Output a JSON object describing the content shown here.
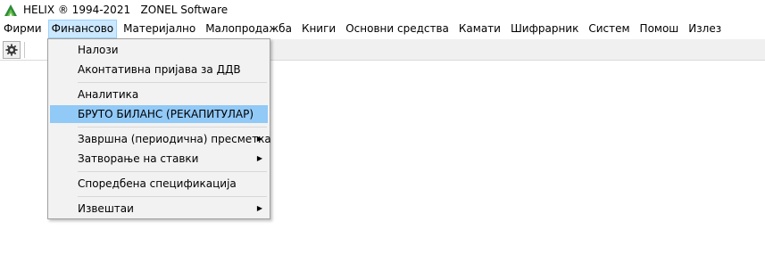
{
  "window": {
    "title": "HELIX ® 1994-2021   ZONEL Software"
  },
  "menubar": {
    "items": [
      "Фирми",
      "Финансово",
      "Материјално",
      "Малопродажба",
      "Книги",
      "Основни средства",
      "Камати",
      "Шифрарник",
      "Систем",
      "Помош",
      "Излез"
    ],
    "active_index": 1
  },
  "toolbar": {
    "settings_icon": "gear-icon"
  },
  "dropdown": {
    "items": [
      {
        "label": "Налози",
        "submenu": false
      },
      {
        "label": "Аконтативна пријава за ДДВ",
        "submenu": false
      },
      {
        "label": "Аналитика",
        "submenu": false
      },
      {
        "label": "БРУТО БИЛАНС (РЕКАПИТУЛАР)",
        "submenu": false,
        "highlighted": true
      },
      {
        "label": "Завршна (периодична) пресметка",
        "submenu": true
      },
      {
        "label": "Затворање на ставки",
        "submenu": true
      },
      {
        "label": "Споредбена спецификација",
        "submenu": false
      },
      {
        "label": "Извештаи",
        "submenu": true
      }
    ],
    "submenu_arrow": "▶"
  },
  "colors": {
    "highlight": "#91c9f7",
    "menu_active": "#cce8ff"
  }
}
